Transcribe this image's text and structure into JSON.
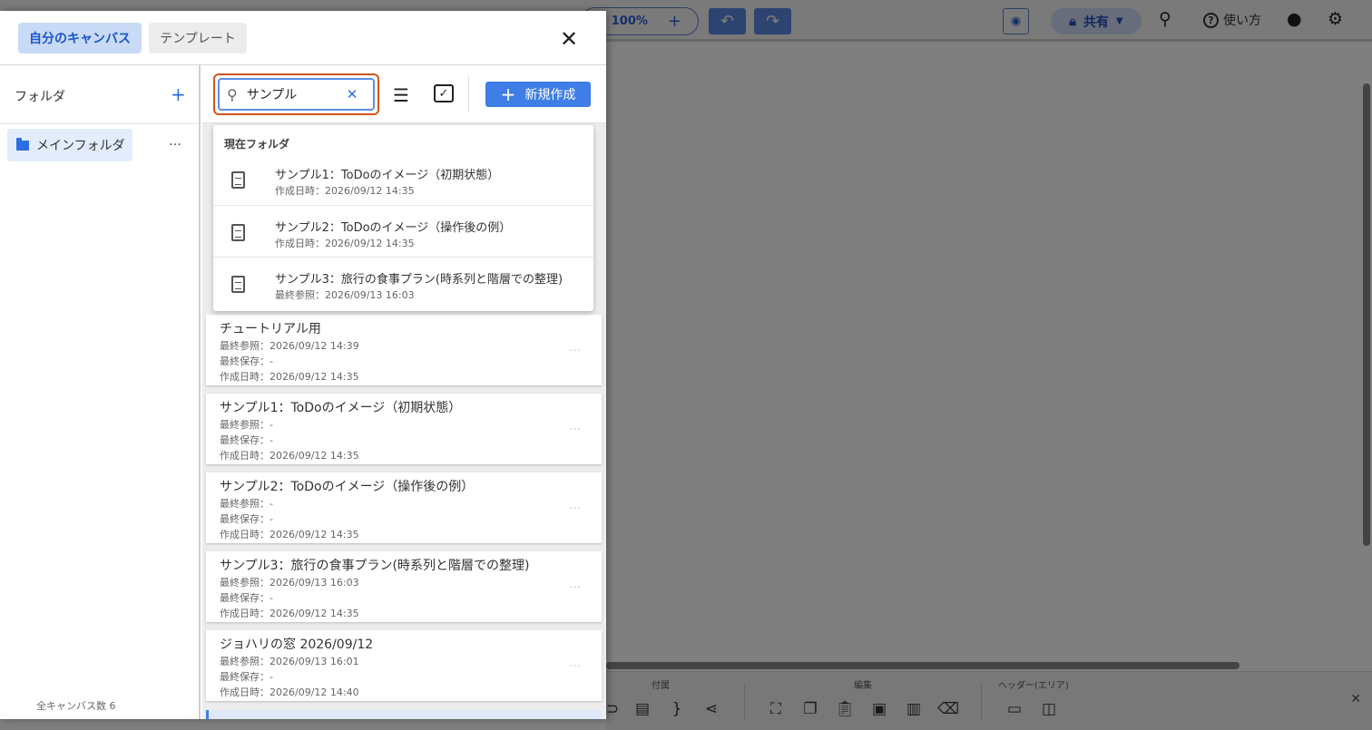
{
  "background": {
    "zoom_value": "100%",
    "share_label": "共有",
    "help_label": "使い方",
    "bottom_groups": [
      "付属",
      "編集",
      "ヘッダー(エリア)"
    ],
    "accent_color": "#3e7ee6"
  },
  "dialog": {
    "tabs": [
      {
        "label": "自分のキャンバス",
        "active": true
      },
      {
        "label": "テンプレート",
        "active": false
      }
    ],
    "close_label": "×",
    "sidebar": {
      "heading": "フォルダ",
      "add_label": "+",
      "folders": [
        {
          "label": "メインフォルダ",
          "selected": true
        }
      ],
      "more_label": "…",
      "total_count": "全キャンバス数 6"
    },
    "toolbar": {
      "search_value": "サンプル",
      "new_button_label": "新規作成",
      "filter_icon": "tune-icon",
      "select_icon": "checklist-icon"
    },
    "dropdown": {
      "title": "現在フォルダ",
      "items": [
        {
          "name": "サンプル1：ToDoのイメージ（初期状態）",
          "date": "作成日時：2026/09/12 14:35"
        },
        {
          "name": "サンプル2：ToDoのイメージ（操作後の例）",
          "date": "作成日時：2026/09/12 14:35"
        },
        {
          "name": "サンプル3：旅行の食事プラン(時系列と階層での整理)",
          "date": "最終参照：2026/09/13 16:03"
        }
      ]
    },
    "cards": [
      {
        "title": "チュートリアル用",
        "last_viewed": "最終参照：2026/09/12 14:39",
        "last_saved": "最終保存：-",
        "created": "作成日時：2026/09/12 14:35"
      },
      {
        "title": "サンプル1：ToDoのイメージ（初期状態）",
        "last_viewed": "最終参照：-",
        "last_saved": "最終保存：-",
        "created": "作成日時：2026/09/12 14:35"
      },
      {
        "title": "サンプル2：ToDoのイメージ（操作後の例）",
        "last_viewed": "最終参照：-",
        "last_saved": "最終保存：-",
        "created": "作成日時：2026/09/12 14:35"
      },
      {
        "title": "サンプル3：旅行の食事プラン(時系列と階層での整理)",
        "last_viewed": "最終参照：2026/09/13 16:03",
        "last_saved": "最終保存：-",
        "created": "作成日時：2026/09/12 14:35"
      },
      {
        "title": "ジョハリの窓 2026/09/12",
        "last_viewed": "最終参照：2026/09/13 16:01",
        "last_saved": "最終保存：-",
        "created": "作成日時：2026/09/12 14:40"
      }
    ],
    "card_more_label": "…"
  }
}
